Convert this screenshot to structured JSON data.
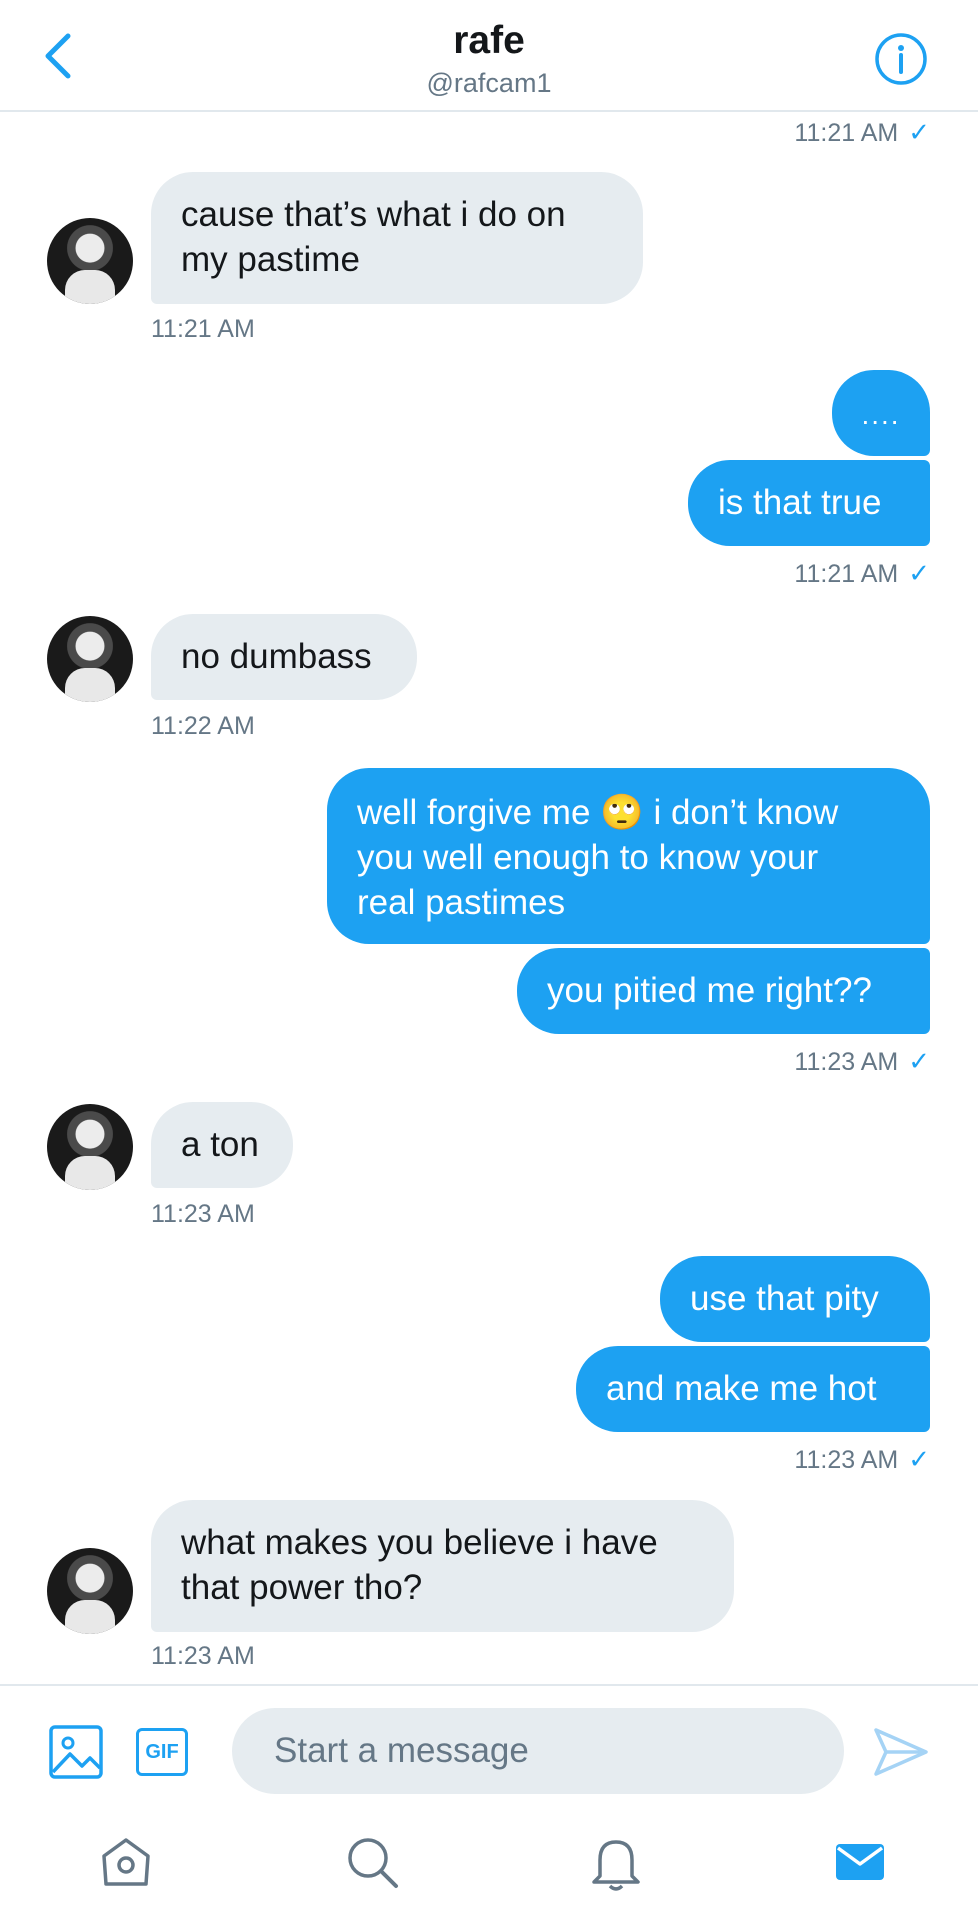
{
  "header": {
    "title": "rafe",
    "handle": "@rafcam1"
  },
  "messages": [
    {
      "id": "m0",
      "side": "out",
      "timestamp": "11:21 AM",
      "read_check": "✓"
    },
    {
      "id": "m1",
      "side": "in",
      "text_lines": [
        "cause that’s what i do on",
        "my pastime"
      ],
      "timestamp": "11:21 AM"
    },
    {
      "id": "m2",
      "side": "out",
      "text": "....",
      "timestamp": ""
    },
    {
      "id": "m3",
      "side": "out",
      "text": "is that true",
      "timestamp": "11:21 AM",
      "read_check": "✓"
    },
    {
      "id": "m4",
      "side": "in",
      "text": "no dumbass",
      "timestamp": "11:22 AM"
    },
    {
      "id": "m5",
      "side": "out",
      "text_lines": [
        "well forgive me 🙄 i don’t know",
        "you well enough to know your",
        "real pastimes"
      ]
    },
    {
      "id": "m6",
      "side": "out",
      "text": "you pitied me right??",
      "timestamp": "11:23 AM",
      "read_check": "✓"
    },
    {
      "id": "m7",
      "side": "in",
      "text": "a ton",
      "timestamp": "11:23 AM"
    },
    {
      "id": "m8",
      "side": "out",
      "text": "use that pity"
    },
    {
      "id": "m9",
      "side": "out",
      "text": "and make me hot",
      "timestamp": "11:23 AM",
      "read_check": "✓"
    },
    {
      "id": "m10",
      "side": "in",
      "text_lines": [
        "what makes you believe i have",
        "that power tho?"
      ],
      "timestamp": "11:23 AM"
    }
  ],
  "composer": {
    "gif_label": "GIF",
    "placeholder": "Start a message"
  },
  "icons": {
    "back": "chevron-left-icon",
    "info": "info-icon",
    "media": "image-icon",
    "send": "send-icon",
    "tabs": [
      "home-icon",
      "search-icon",
      "bell-icon",
      "mail-icon"
    ]
  },
  "colors": {
    "accent": "#1da1f2",
    "incoming_bubble": "#e6ecf0",
    "muted_text": "#657786",
    "divider": "#e1e8ed"
  }
}
